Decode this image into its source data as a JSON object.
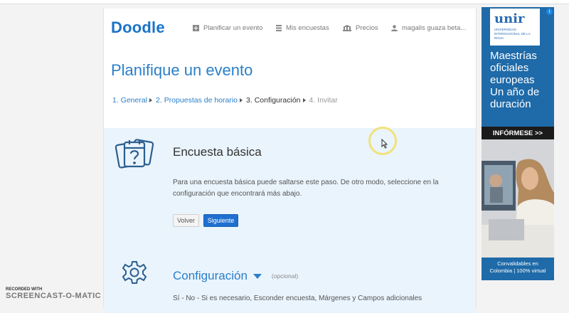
{
  "header": {
    "logo": "Doodle",
    "nav": [
      {
        "label": "Planificar un evento",
        "icon": "plus-icon"
      },
      {
        "label": "Mis encuestas",
        "icon": "list-icon"
      },
      {
        "label": "Precios",
        "icon": "pricing-icon"
      },
      {
        "label": "magalis guaza beta...",
        "icon": "user-icon"
      }
    ]
  },
  "page": {
    "title": "Planifique un evento"
  },
  "steps": [
    {
      "label": "1. General",
      "state": "done"
    },
    {
      "label": "2. Propuestas de horario",
      "state": "done"
    },
    {
      "label": "3. Configuración",
      "state": "current"
    },
    {
      "label": "4. Invitar",
      "state": "upcoming"
    }
  ],
  "basic": {
    "title": "Encuesta básica",
    "description": "Para una encuesta básica puede saltarse este paso. De otro modo, seleccione en la configuración que encontrará más abajo.",
    "back_label": "Volver",
    "next_label": "Siguiente"
  },
  "config": {
    "title": "Configuración",
    "optional": "(opcional)",
    "description": "Sí - No - Si es necesario, Esconder encuesta, Márgenes y Campos adicionales"
  },
  "ad": {
    "brand": "unir",
    "brand_sub": "UNIVERSIDAD INTERNACIONAL DE LA RIOJA",
    "headline_lines": [
      "Maestrías",
      "oficiales",
      "europeas",
      "Un año de",
      "duración"
    ],
    "cta": "INFÓRMESE >>",
    "footer_line1": "Convalidables en",
    "footer_line2": "Colombia | 100% virtual"
  },
  "watermark": {
    "line1": "RECORDED WITH",
    "line2": "SCREENCAST-O-MATIC"
  },
  "colors": {
    "brand_blue": "#1a73c8",
    "link_blue": "#2a7fc9",
    "panel_bg": "#eaf4fc",
    "primary_button": "#1f6fd0",
    "ad_blue": "#1f6aa8"
  }
}
